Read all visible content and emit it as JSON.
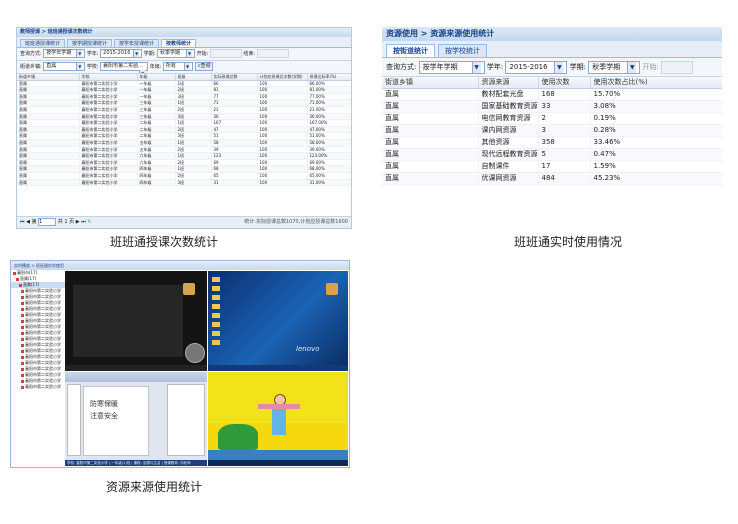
{
  "panel1": {
    "title": "教师授课 > 班班通授课次数统计",
    "tabs": [
      "班班通授课统计",
      "按学期授课统计",
      "按学年授课统计",
      "按教师统计"
    ],
    "active_tab": 3,
    "toolbar1": {
      "query_label": "查询方式:",
      "query_value": "按学年学期",
      "year_label": "学年:",
      "year_value": "2015-2016",
      "semester_label": "学期:",
      "semester_value": "秋季学期",
      "start_label": "开始:",
      "end_label": "结束:"
    },
    "toolbar2": {
      "town_label": "街道乡镇:",
      "town_value": "直属",
      "school_label": "学校:",
      "school_value": "襄阳市第二实验...",
      "grade_label": "年级:",
      "grade_value": "所有",
      "search_label": "查询"
    },
    "columns": [
      "街道乡镇",
      "学校",
      "年级",
      "班级",
      "实际授课总数",
      "计划应授课总次数(学期)",
      "授课达标率(%)"
    ],
    "rows": [
      [
        "直属",
        "襄阳市第二实验小学",
        "一年级",
        "1班",
        "66",
        "100",
        "66.00%"
      ],
      [
        "直属",
        "襄阳市第二实验小学",
        "一年级",
        "2班",
        "81",
        "100",
        "81.00%"
      ],
      [
        "直属",
        "襄阳市第二实验小学",
        "一年级",
        "3班",
        "77",
        "100",
        "77.00%"
      ],
      [
        "直属",
        "襄阳市第二实验小学",
        "三年级",
        "1班",
        "71",
        "100",
        "71.00%"
      ],
      [
        "直属",
        "襄阳市第二实验小学",
        "三年级",
        "2班",
        "21",
        "100",
        "21.00%"
      ],
      [
        "直属",
        "襄阳市第二实验小学",
        "三年级",
        "3班",
        "36",
        "100",
        "36.00%"
      ],
      [
        "直属",
        "襄阳市第二实验小学",
        "二年级",
        "1班",
        "167",
        "100",
        "167.00%"
      ],
      [
        "直属",
        "襄阳市第二实验小学",
        "二年级",
        "2班",
        "47",
        "100",
        "47.00%"
      ],
      [
        "直属",
        "襄阳市第二实验小学",
        "二年级",
        "3班",
        "51",
        "100",
        "51.00%"
      ],
      [
        "直属",
        "襄阳市第二实验小学",
        "五年级",
        "1班",
        "58",
        "100",
        "58.00%"
      ],
      [
        "直属",
        "襄阳市第二实验小学",
        "五年级",
        "2班",
        "39",
        "100",
        "39.00%"
      ],
      [
        "直属",
        "襄阳市第二实验小学",
        "六年级",
        "1班",
        "123",
        "100",
        "123.00%"
      ],
      [
        "直属",
        "襄阳市第二实验小学",
        "六年级",
        "2班",
        "69",
        "100",
        "69.00%"
      ],
      [
        "直属",
        "襄阳市第二实验小学",
        "四年级",
        "1班",
        "68",
        "100",
        "68.00%"
      ],
      [
        "直属",
        "襄阳市第二实验小学",
        "四年级",
        "2班",
        "65",
        "100",
        "65.00%"
      ],
      [
        "直属",
        "襄阳市第二实验小学",
        "四年级",
        "3班",
        "31",
        "100",
        "31.00%"
      ]
    ],
    "pager": {
      "page_label": "第",
      "page_value": "1",
      "total": "共 1 页",
      "status": "统计:实际授课总数1070,计划应授课总数1600"
    },
    "caption": "班班通授课次数统计"
  },
  "panel2": {
    "title": "资源使用 > 资源来源使用统计",
    "tabs": [
      "按街道统计",
      "按学校统计"
    ],
    "active_tab": 0,
    "toolbar": {
      "query_label": "查询方式:",
      "query_value": "按学年学期",
      "year_label": "学年:",
      "year_value": "2015-2016",
      "semester_label": "学期:",
      "semester_value": "秋季学期",
      "start_label": "开始:"
    },
    "columns": [
      "街道乡镇",
      "资源来源",
      "使用次数",
      "使用次数占比(%)"
    ],
    "rows": [
      [
        "直属",
        "教材配套光盘",
        "168",
        "15.70%"
      ],
      [
        "直属",
        "国家基础教育资源",
        "33",
        "3.08%"
      ],
      [
        "直属",
        "电信网教育资源",
        "2",
        "0.19%"
      ],
      [
        "直属",
        "课内网资源",
        "3",
        "0.28%"
      ],
      [
        "直属",
        "其他资源",
        "358",
        "33.46%"
      ],
      [
        "直属",
        "现代远程教育资源",
        "5",
        "0.47%"
      ],
      [
        "直属",
        "自制课件",
        "17",
        "1.59%"
      ],
      [
        "直属",
        "优课网资源",
        "484",
        "45.23%"
      ]
    ],
    "caption": "班班通实时使用情况"
  },
  "panel3": {
    "title": "实时播放 > 班班通实时使用",
    "tree": [
      "襄阳市(17)",
      "直属(17)",
      "直属(17)",
      "襄阳市第二实验小学",
      "襄阳市第二实验小学",
      "襄阳市第二实验小学",
      "襄阳市第二实验小学",
      "襄阳市第二实验小学",
      "襄阳市第二实验小学",
      "襄阳市第二实验小学",
      "襄阳市第二实验小学",
      "襄阳市第二实验小学",
      "襄阳市第二实验小学",
      "襄阳市第二实验小学",
      "襄阳市第二实验小学",
      "襄阳市第二实验小学",
      "襄阳市第二实验小学",
      "襄阳市第二实验小学",
      "襄阳市第二实验小学",
      "襄阳市第二实验小学"
    ],
    "screen_text_1": "防寒保暖",
    "screen_text_2": "注意安全",
    "brand": "lenovo",
    "status_bar": "学校: 襄阳市第二实验小学 | 一年级(1)班 | 课程: 品德与生活 | 授课教师: 刘老师",
    "caption": "资源来源使用统计"
  }
}
